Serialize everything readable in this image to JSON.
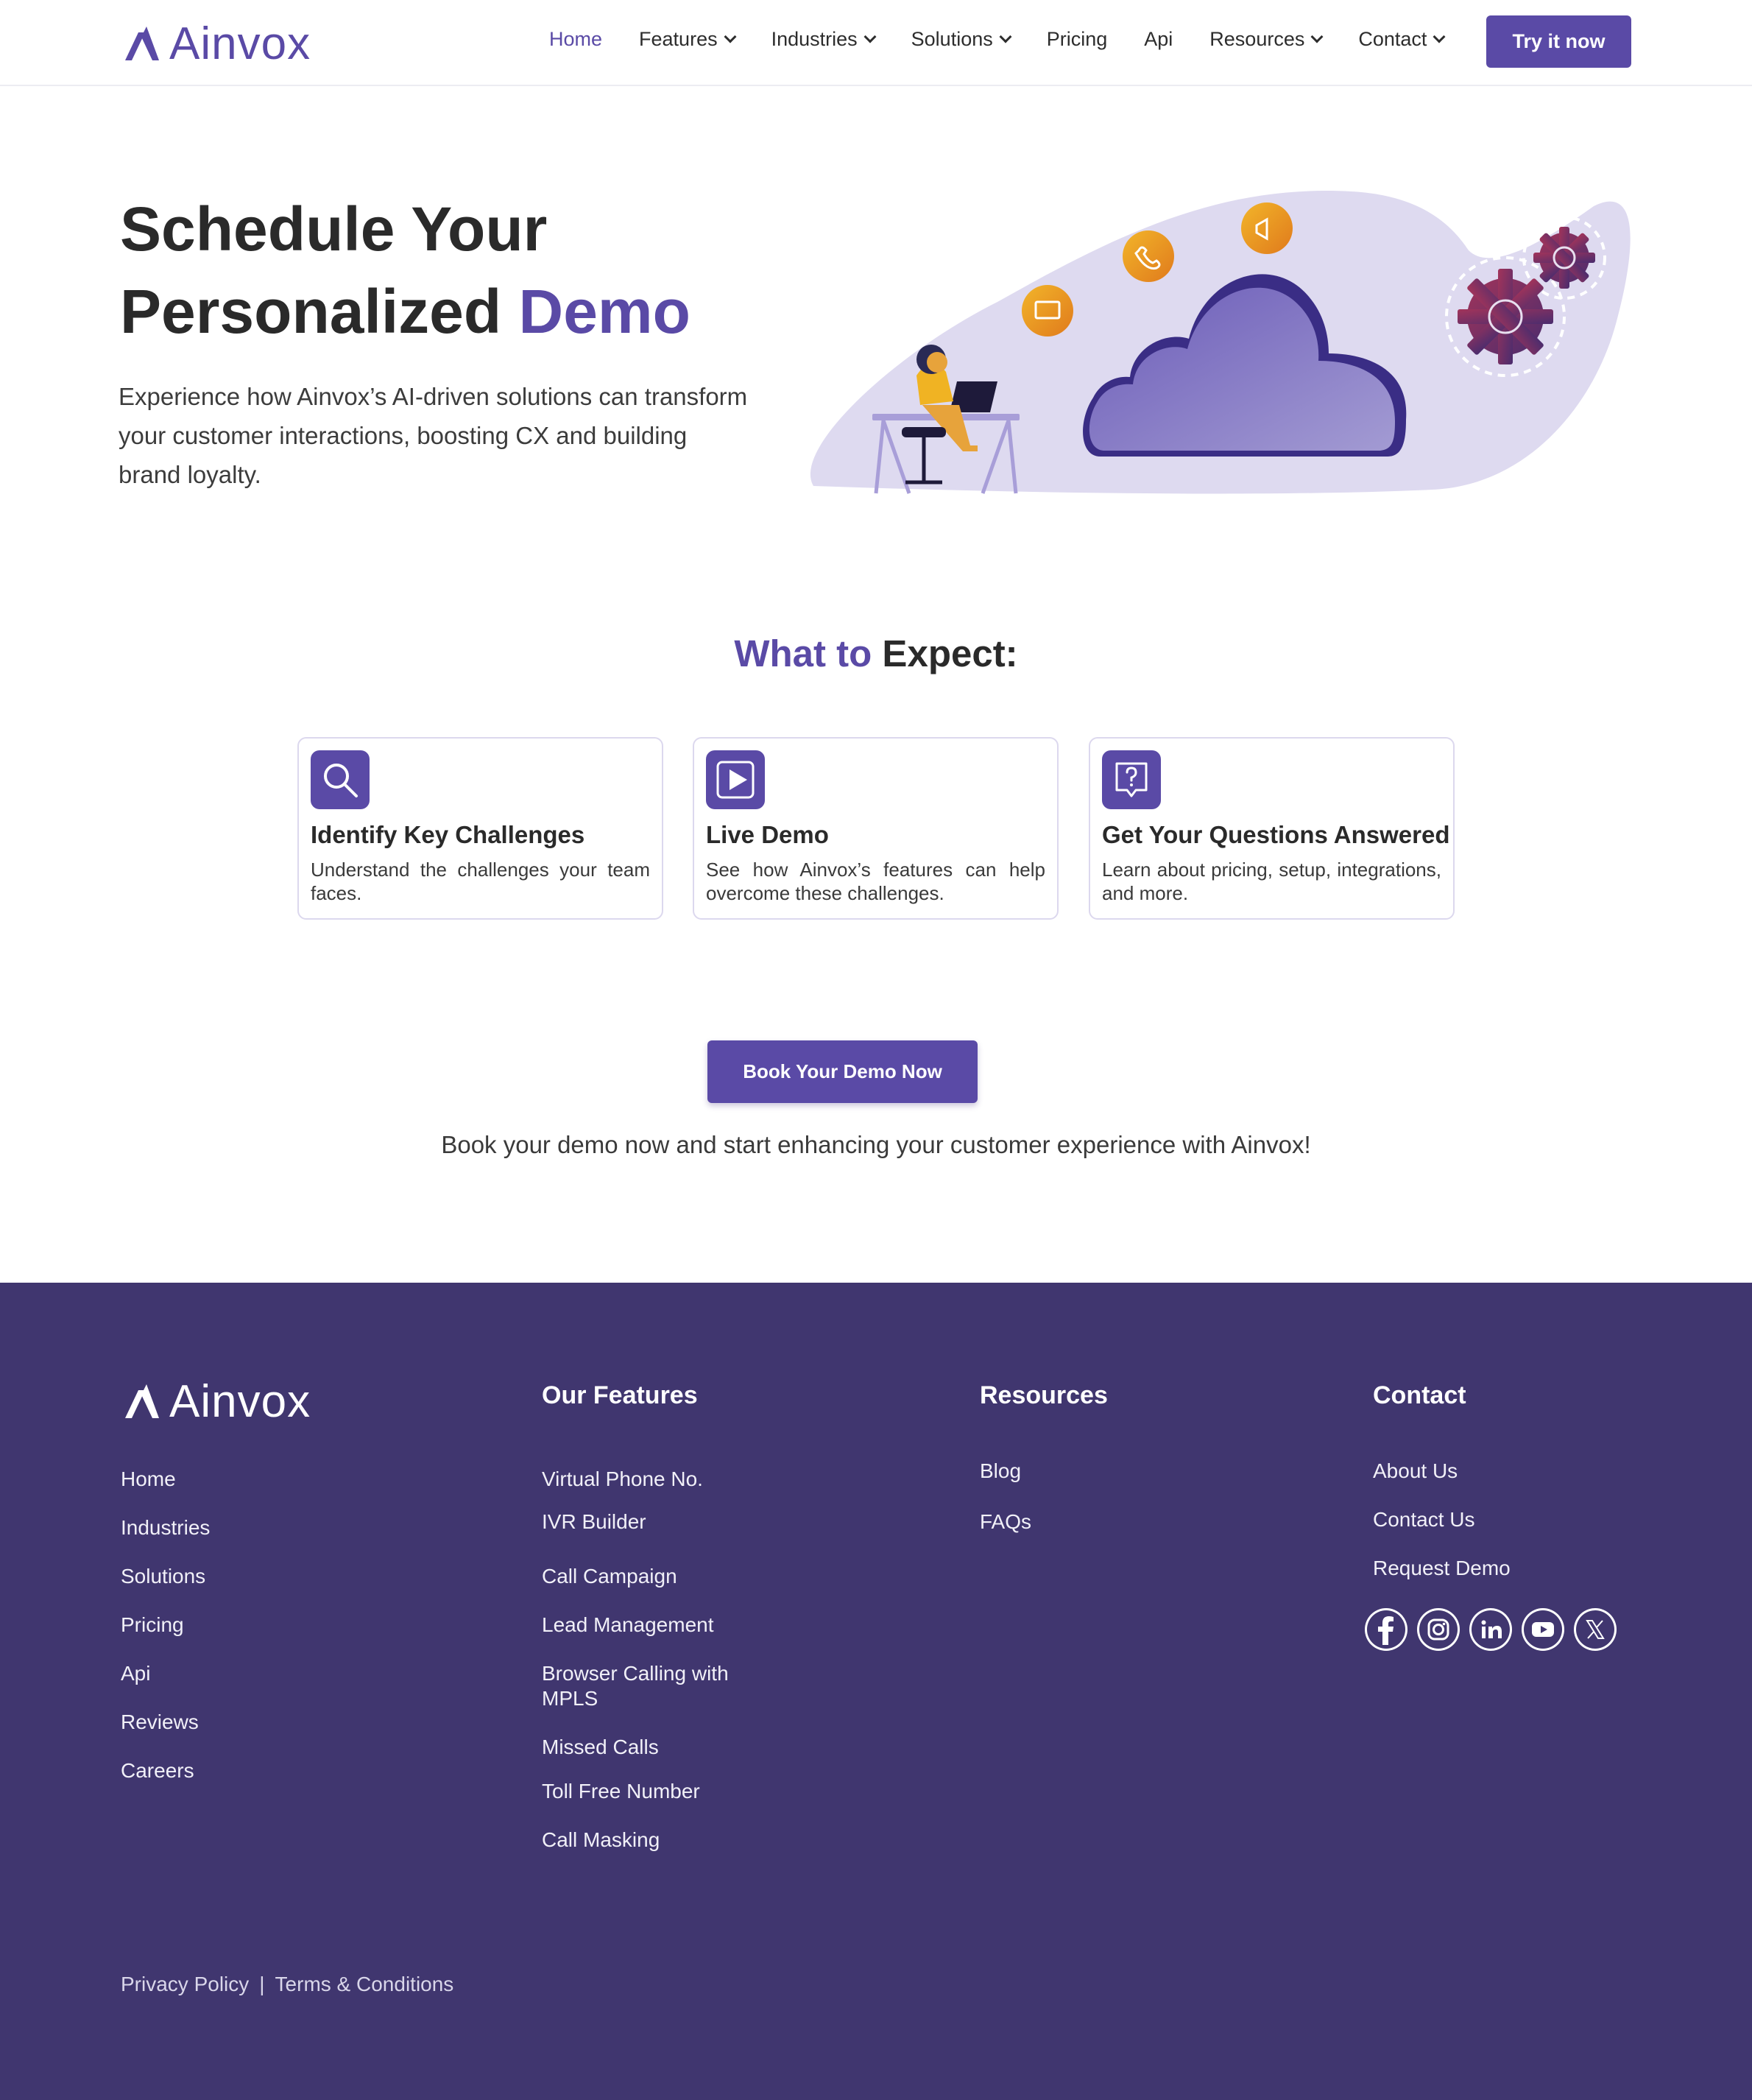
{
  "brand": {
    "name": "Ainvox",
    "accent_color": "#5a4aa6",
    "footer_bg": "#40366f"
  },
  "nav": {
    "items": [
      {
        "label": "Home",
        "active": true,
        "dropdown": false
      },
      {
        "label": "Features",
        "dropdown": true
      },
      {
        "label": "Industries",
        "dropdown": true
      },
      {
        "label": "Solutions",
        "dropdown": true
      },
      {
        "label": "Pricing",
        "dropdown": false
      },
      {
        "label": "Api",
        "dropdown": false
      },
      {
        "label": "Resources",
        "dropdown": true
      },
      {
        "label": "Contact",
        "dropdown": true
      }
    ],
    "cta_label": "Try it now"
  },
  "hero": {
    "title_line1": "Schedule Your",
    "title_line2_plain": "Personalized ",
    "title_line2_accent": "Demo",
    "subtitle": "Experience how Ainvox’s AI-driven solutions can transform your customer interactions, boosting CX and building brand loyalty."
  },
  "expect": {
    "title_accent": "What to",
    "title_plain": " Expect:",
    "cards": [
      {
        "icon": "search-icon",
        "title": "Identify Key Challenges",
        "text": "Understand the challenges your team faces."
      },
      {
        "icon": "play-icon",
        "title": "Live Demo",
        "text": "See how Ainvox’s features can help overcome these challenges."
      },
      {
        "icon": "question-icon",
        "title": "Get Your Questions Answered",
        "text": "Learn about pricing, setup, integrations, and more."
      }
    ]
  },
  "booking": {
    "button_label": "Book Your Demo Now",
    "note": "Book your demo now and start enhancing your customer experience with Ainvox!"
  },
  "footer": {
    "main_links": [
      "Home",
      "Industries",
      "Solutions",
      "Pricing",
      "Api",
      "Reviews",
      "Careers"
    ],
    "features_title": "Our Features",
    "features_links": [
      "Virtual Phone No.",
      "IVR Builder",
      "Call Campaign",
      "Lead Management",
      "Browser Calling with MPLS",
      "Missed Calls",
      "Toll Free Number",
      "Call Masking"
    ],
    "resources_title": "Resources",
    "resources_links": [
      "Blog",
      "FAQs"
    ],
    "contact_title": "Contact",
    "contact_links": [
      "About Us",
      "Contact Us",
      "Request Demo"
    ],
    "socials": [
      "facebook-icon",
      "instagram-icon",
      "linkedin-icon",
      "youtube-icon",
      "x-icon"
    ],
    "privacy": "Privacy Policy",
    "separator": "|",
    "terms": "Terms & Conditions"
  }
}
